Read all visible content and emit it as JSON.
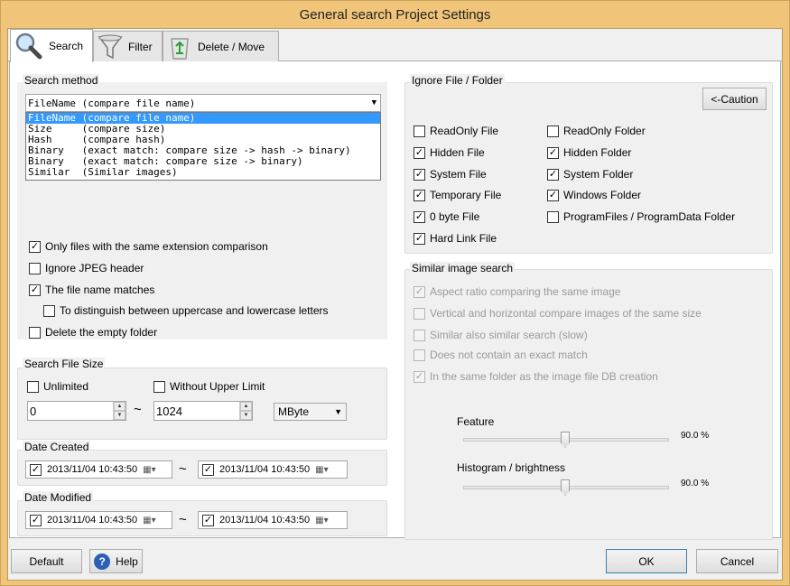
{
  "window": {
    "title": "General search Project Settings"
  },
  "tabs": [
    {
      "label": "Search",
      "icon": "magnifier-icon"
    },
    {
      "label": "Filter",
      "icon": "funnel-icon"
    },
    {
      "label": "Delete / Move",
      "icon": "recycle-bin-icon"
    }
  ],
  "search_method": {
    "title": "Search method",
    "selected": "FileName (compare file name)",
    "options": [
      "FileName (compare file name)",
      "Size     (compare size)",
      "Hash     (compare hash)",
      "Binary   (exact match: compare size -> hash -> binary)",
      "Binary   (exact match: compare size -> binary)",
      "Similar  (Similar images)"
    ],
    "checks": [
      {
        "label": "Only files with the same extension comparison",
        "checked": true
      },
      {
        "label": "Ignore JPEG header",
        "checked": false
      },
      {
        "label": "The file name matches",
        "checked": true
      },
      {
        "label": "To distinguish between uppercase and lowercase letters",
        "checked": false
      },
      {
        "label": "Delete the empty folder",
        "checked": false
      }
    ]
  },
  "file_size": {
    "title": "Search File Size",
    "unlimited_label": "Unlimited",
    "no_upper_label": "Without Upper Limit",
    "min": "0",
    "tilde": "~",
    "max": "1024",
    "unit": "MByte"
  },
  "date_created": {
    "title": "Date Created",
    "from": "2013/11/04 10:43:50",
    "to": "2013/11/04 10:43:50"
  },
  "date_modified": {
    "title": "Date Modified",
    "from": "2013/11/04 10:43:50",
    "to": "2013/11/04 10:43:50"
  },
  "ignore": {
    "title": "Ignore File / Folder",
    "caution_button": "<-Caution",
    "left": [
      {
        "label": "ReadOnly File",
        "checked": false
      },
      {
        "label": "Hidden File",
        "checked": true
      },
      {
        "label": "System File",
        "checked": true
      },
      {
        "label": "Temporary File",
        "checked": true
      },
      {
        "label": "0 byte File",
        "checked": true
      },
      {
        "label": "Hard Link File",
        "checked": true
      }
    ],
    "right": [
      {
        "label": "ReadOnly Folder",
        "checked": false
      },
      {
        "label": "Hidden Folder",
        "checked": true
      },
      {
        "label": "System Folder",
        "checked": true
      },
      {
        "label": "Windows Folder",
        "checked": true
      },
      {
        "label": "ProgramFiles / ProgramData Folder",
        "checked": false
      }
    ]
  },
  "similar": {
    "title": "Similar image search",
    "options": [
      {
        "label": "Aspect ratio comparing the same image",
        "checked": true
      },
      {
        "label": "Vertical and horizontal compare images of the same size",
        "checked": false
      },
      {
        "label": "Similar also similar search (slow)",
        "checked": false
      },
      {
        "label": "Does not contain an exact match",
        "checked": false
      },
      {
        "label": "In the same folder as the image file DB creation",
        "checked": true
      }
    ],
    "feature_label": "Feature",
    "feature_value": "90.0 %",
    "histogram_label": "Histogram / brightness",
    "histogram_value": "90.0 %"
  },
  "footer": {
    "default": "Default",
    "help": "Help",
    "ok": "OK",
    "cancel": "Cancel"
  }
}
